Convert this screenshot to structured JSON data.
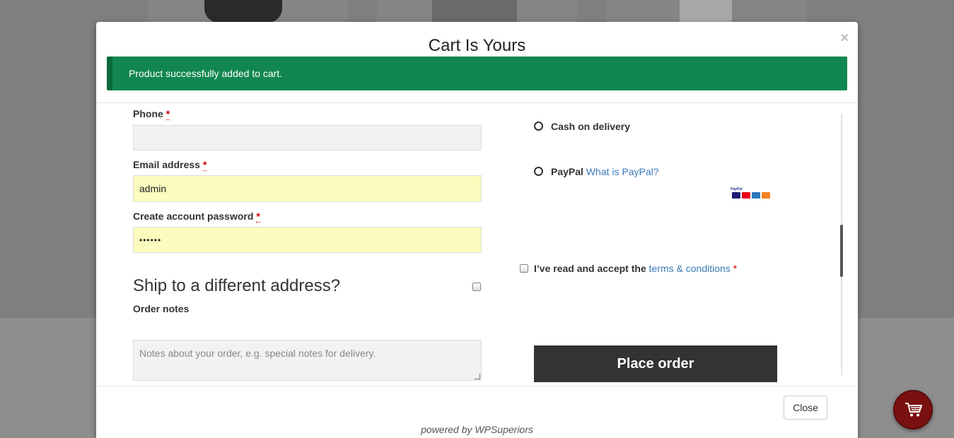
{
  "modal": {
    "title": "Cart Is Yours",
    "close_x": "×",
    "notice": "Product successfully added to cart."
  },
  "form": {
    "phone_label": "Phone",
    "phone_value": "",
    "email_label": "Email address",
    "email_value": "admin",
    "password_label": "Create account password",
    "password_value": "••••••",
    "required_mark": "*",
    "ship_heading": "Ship to a different address?",
    "order_notes_label": "Order notes",
    "order_notes_placeholder": "Notes about your order, e.g. special notes for delivery."
  },
  "payment": {
    "cod_label": "Cash on delivery",
    "paypal_label": "PayPal",
    "paypal_link": "What is PayPal?",
    "terms_prefix": "I’ve read and accept the",
    "terms_link": "terms & conditions",
    "place_order": "Place order"
  },
  "footer": {
    "close_label": "Close",
    "powered_prefix": "powered by ",
    "powered_brand": "WPSuperiors"
  },
  "colors": {
    "notice_bg": "#11874f",
    "button_dark": "#333333",
    "cart_fab": "#7a1010",
    "link": "#3b7ab6"
  },
  "icons": [
    "close-icon",
    "paypal-cards-icon",
    "cart-icon"
  ]
}
